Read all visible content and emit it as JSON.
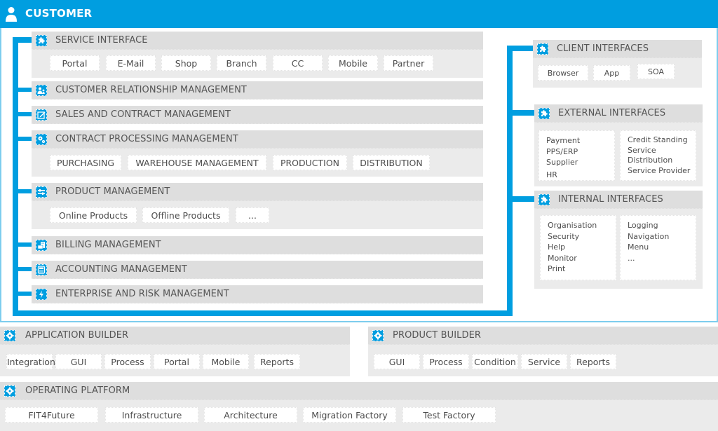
{
  "customer": {
    "title": "CUSTOMER",
    "icon": "user-icon"
  },
  "colors": {
    "accent": "#009ee0",
    "frame": "#7dcdee",
    "module_bg": "#ebebeb",
    "module_head": "#dedede",
    "text": "#555555"
  },
  "left_modules": [
    {
      "title": "SERVICE INTERFACE",
      "icon": "puzzle-icon",
      "items": [
        "Portal",
        "E-Mail",
        "Shop",
        "Branch",
        "CC",
        "Mobile",
        "Partner"
      ]
    },
    {
      "title": "CUSTOMER RELATIONSHIP MANAGEMENT",
      "icon": "users-icon",
      "items": []
    },
    {
      "title": "SALES AND CONTRACT MANAGEMENT",
      "icon": "edit-icon",
      "items": []
    },
    {
      "title": "CONTRACT PROCESSING MANAGEMENT",
      "icon": "gears-icon",
      "items": [
        "PURCHASING",
        "WAREHOUSE MANAGEMENT",
        "PRODUCTION",
        "DISTRIBUTION"
      ]
    },
    {
      "title": "PRODUCT MANAGEMENT",
      "icon": "tools-icon",
      "items": [
        "Online Products",
        "Offline Products",
        "..."
      ]
    },
    {
      "title": "BILLING MANAGEMENT",
      "icon": "cash-icon",
      "items": []
    },
    {
      "title": "ACCOUNTING MANAGEMENT",
      "icon": "calculator-icon",
      "items": []
    },
    {
      "title": "ENTERPRISE AND RISK MANAGEMENT",
      "icon": "lightning-icon",
      "items": []
    }
  ],
  "right_modules": [
    {
      "title": "CLIENT INTERFACES",
      "icon": "puzzle-icon",
      "items": [
        "Browser",
        "App",
        "SOA"
      ]
    },
    {
      "title": "EXTERNAL INTERFACES",
      "icon": "puzzle-icon",
      "columns": [
        [
          "Payment",
          "PPS/ERP",
          "Supplier",
          "HR"
        ],
        [
          "Credit Standing",
          "Service",
          "Distribution",
          "Service Provider"
        ]
      ]
    },
    {
      "title": "INTERNAL INTERFACES",
      "icon": "puzzle-icon",
      "columns": [
        [
          "Organisation",
          "Security",
          "Help",
          "Monitor",
          "Print"
        ],
        [
          "Logging",
          "Navigation",
          "Menu",
          "..."
        ]
      ]
    }
  ],
  "application_builder": {
    "title": "APPLICATION BUILDER",
    "icon": "gear-icon",
    "items": [
      "Integration",
      "GUI",
      "Process",
      "Portal",
      "Mobile",
      "Reports"
    ]
  },
  "product_builder": {
    "title": "PRODUCT BUILDER",
    "icon": "gear-icon",
    "items": [
      "GUI",
      "Process",
      "Condition",
      "Service",
      "Reports"
    ]
  },
  "operating_platform": {
    "title": "OPERATING PLATFORM",
    "icon": "gear-icon",
    "items": [
      "FIT4Future",
      "Infrastructure",
      "Architecture",
      "Migration Factory",
      "Test Factory"
    ]
  }
}
